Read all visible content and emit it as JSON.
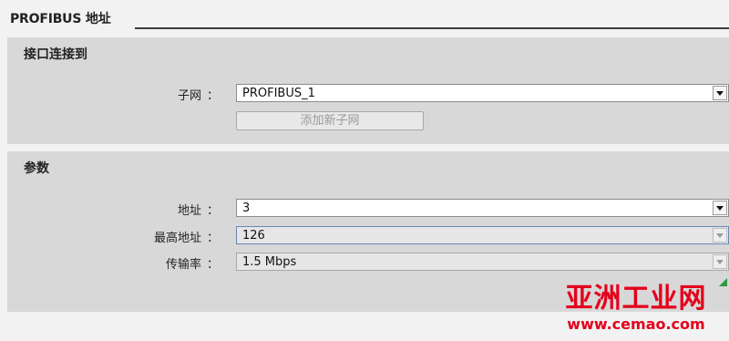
{
  "section": {
    "title": "PROFIBUS 地址"
  },
  "interface": {
    "heading": "接口连接到",
    "subnet_label": "子网",
    "colon": "：",
    "subnet_value": "PROFIBUS_1",
    "add_subnet_button": "添加新子网"
  },
  "parameters": {
    "heading": "参数",
    "address_label": "地址",
    "address_value": "3",
    "highest_address_label": "最高地址",
    "highest_address_value": "126",
    "baud_rate_label": "传输率",
    "baud_rate_value": "1.5 Mbps",
    "colon": "："
  },
  "watermark": {
    "title": "亚洲工业网",
    "url": "www.cemao.com"
  },
  "colors": {
    "panel": "#d8d8d8",
    "background": "#f2f2f2",
    "watermark": "#e3001b",
    "corner_mark": "#2e9a3c"
  }
}
